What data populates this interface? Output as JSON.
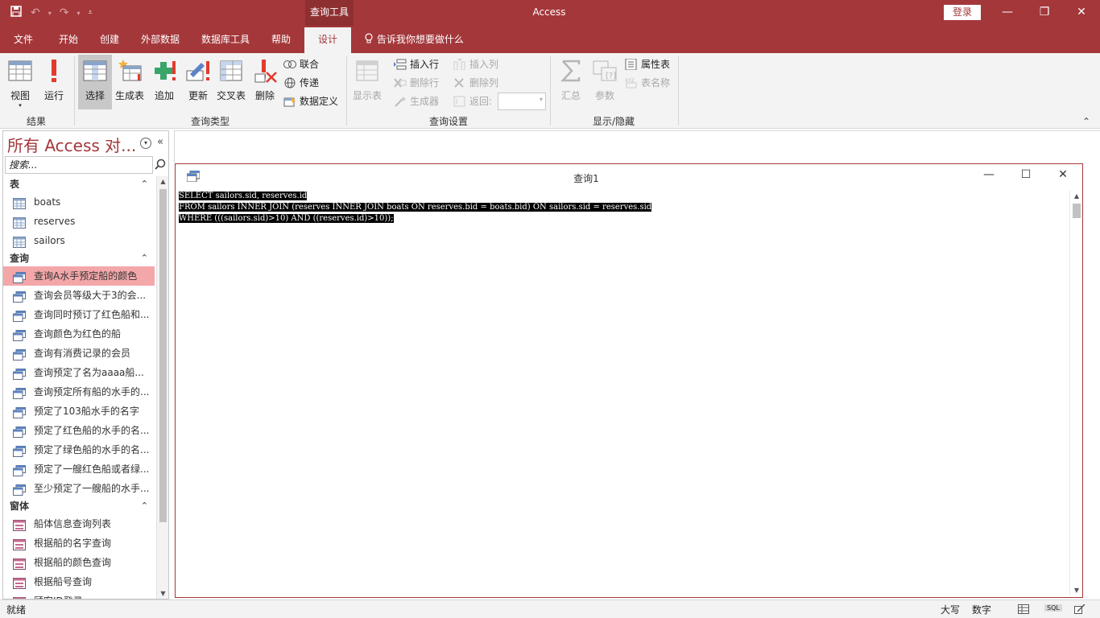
{
  "titlebar": {
    "context_tab": "查询工具",
    "app_title": "Access",
    "login": "登录"
  },
  "tabs": [
    "文件",
    "开始",
    "创建",
    "外部数据",
    "数据库工具",
    "帮助",
    "设计"
  ],
  "active_tab": "设计",
  "tellme": "告诉我你想要做什么",
  "ribbon": {
    "results": {
      "label": "结果",
      "view": "视图",
      "run": "运行"
    },
    "query_type": {
      "label": "查询类型",
      "select": "选择",
      "make_table": "生成表",
      "append": "追加",
      "update": "更新",
      "crosstab": "交叉表",
      "delete": "删除",
      "union": "联合",
      "pass_through": "传递",
      "data_definition": "数据定义"
    },
    "query_setup": {
      "label": "查询设置",
      "show_table": "显示表",
      "insert_rows": "插入行",
      "delete_rows": "删除行",
      "builder": "生成器",
      "insert_columns": "插入列",
      "delete_columns": "删除列",
      "return": "返回:"
    },
    "show_hide": {
      "label": "显示/隐藏",
      "totals": "汇总",
      "parameters": "参数",
      "property_sheet": "属性表",
      "table_names": "表名称"
    }
  },
  "nav": {
    "title": "所有 Access 对...",
    "search_placeholder": "搜索...",
    "sections": [
      {
        "label": "表",
        "type": "table",
        "items": [
          "boats",
          "reserves",
          "sailors"
        ]
      },
      {
        "label": "查询",
        "type": "query",
        "items": [
          "查询A水手预定船的颜色",
          "查询会员等级大于3的会...",
          "查询同时预订了红色船和...",
          "查询颜色为红色的船",
          "查询有消费记录的会员",
          "查询预定了名为aaaa船...",
          "查询预定所有船的水手的...",
          "预定了103船水手的名字",
          "预定了红色船的水手的名...",
          "预定了绿色船的水手的名...",
          "预定了一艘红色船或者绿...",
          "至少预定了一艘船的水手..."
        ]
      },
      {
        "label": "窗体",
        "type": "form",
        "items": [
          "船体信息查询列表",
          "根据船的名字查询",
          "根据船的颜色查询",
          "根据船号查询",
          "顾客ID登录"
        ]
      }
    ],
    "active_item": "查询A水手预定船的颜色"
  },
  "query_window": {
    "title": "查询1",
    "sql_lines": [
      "SELECT sailors.sid, reserves.id",
      "FROM sailors INNER JOIN (reserves INNER JOIN boats ON reserves.bid = boats.bid) ON sailors.sid = reserves.sid",
      "WHERE (((sailors.sid)>10) AND ((reserves.id)>10));"
    ]
  },
  "statusbar": {
    "left": "就绪",
    "caps": "大写",
    "num": "数字",
    "sql": "SQL"
  },
  "colors": {
    "accent": "#a4373a",
    "active_nav": "#f3a7a9"
  }
}
